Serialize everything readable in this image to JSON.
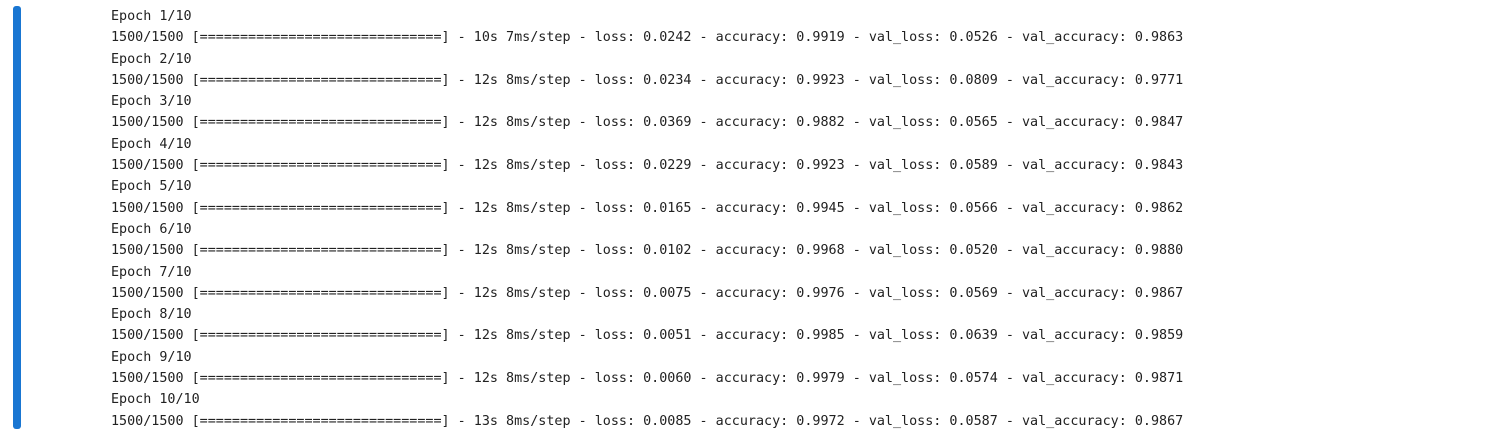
{
  "output": {
    "lines": [
      "Epoch 1/10",
      "1500/1500 [==============================] - 10s 7ms/step - loss: 0.0242 - accuracy: 0.9919 - val_loss: 0.0526 - val_accuracy: 0.9863",
      "Epoch 2/10",
      "1500/1500 [==============================] - 12s 8ms/step - loss: 0.0234 - accuracy: 0.9923 - val_loss: 0.0809 - val_accuracy: 0.9771",
      "Epoch 3/10",
      "1500/1500 [==============================] - 12s 8ms/step - loss: 0.0369 - accuracy: 0.9882 - val_loss: 0.0565 - val_accuracy: 0.9847",
      "Epoch 4/10",
      "1500/1500 [==============================] - 12s 8ms/step - loss: 0.0229 - accuracy: 0.9923 - val_loss: 0.0589 - val_accuracy: 0.9843",
      "Epoch 5/10",
      "1500/1500 [==============================] - 12s 8ms/step - loss: 0.0165 - accuracy: 0.9945 - val_loss: 0.0566 - val_accuracy: 0.9862",
      "Epoch 6/10",
      "1500/1500 [==============================] - 12s 8ms/step - loss: 0.0102 - accuracy: 0.9968 - val_loss: 0.0520 - val_accuracy: 0.9880",
      "Epoch 7/10",
      "1500/1500 [==============================] - 12s 8ms/step - loss: 0.0075 - accuracy: 0.9976 - val_loss: 0.0569 - val_accuracy: 0.9867",
      "Epoch 8/10",
      "1500/1500 [==============================] - 12s 8ms/step - loss: 0.0051 - accuracy: 0.9985 - val_loss: 0.0639 - val_accuracy: 0.9859",
      "Epoch 9/10",
      "1500/1500 [==============================] - 12s 8ms/step - loss: 0.0060 - accuracy: 0.9979 - val_loss: 0.0574 - val_accuracy: 0.9871",
      "Epoch 10/10",
      "1500/1500 [==============================] - 13s 8ms/step - loss: 0.0085 - accuracy: 0.9972 - val_loss: 0.0587 - val_accuracy: 0.9867"
    ]
  },
  "colors": {
    "indicator": "#1976d2",
    "text": "#212121",
    "background": "#ffffff"
  }
}
